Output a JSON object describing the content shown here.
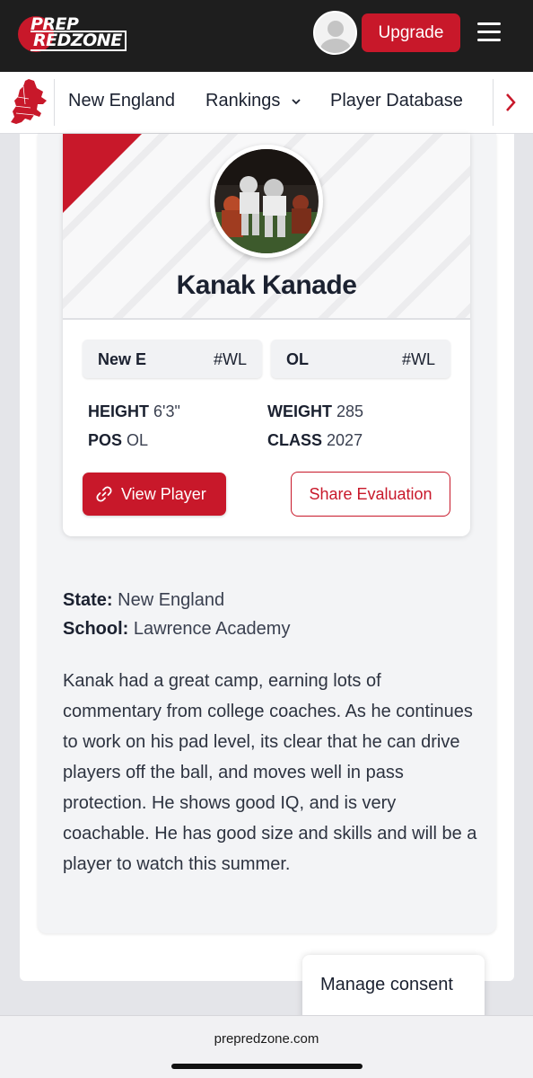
{
  "header": {
    "logo_line1": "PREP",
    "logo_line2": "REDZONE",
    "upgrade_label": "Upgrade"
  },
  "nav": {
    "items": [
      "New England",
      "Rankings",
      "Player Database"
    ],
    "rankings_dropdown": true
  },
  "player": {
    "name": "Kanak Kanade",
    "tags": [
      {
        "label": "New E",
        "rank": "#WL"
      },
      {
        "label": "OL",
        "rank": "#WL"
      }
    ],
    "stats": {
      "height_label": "HEIGHT",
      "height": "6'3\"",
      "weight_label": "WEIGHT",
      "weight": "285",
      "pos_label": "POS",
      "pos": "OL",
      "class_label": "CLASS",
      "class": "2027"
    },
    "view_label": "View Player",
    "share_label": "Share Evaluation"
  },
  "details": {
    "state_label": "State:",
    "state": "New England",
    "school_label": "School:",
    "school": "Lawrence Academy",
    "evaluation": "Kanak had a great camp, earning lots of commentary from college coaches. As he continues to work on his pad level, its clear that he can drive players off the ball, and moves well in pass protection. He shows good IQ, and is very coachable. He has good size and skills and will be a player to watch this summer."
  },
  "consent_label": "Manage consent",
  "browser": {
    "url": "prepredzone.com"
  },
  "colors": {
    "brand_red": "#c8182a",
    "header_bg": "#1e1e1e"
  },
  "icons": [
    "user-avatar-icon",
    "hamburger-menu-icon",
    "new-england-map-icon",
    "chevron-down-icon",
    "chevron-right-icon",
    "link-icon"
  ]
}
